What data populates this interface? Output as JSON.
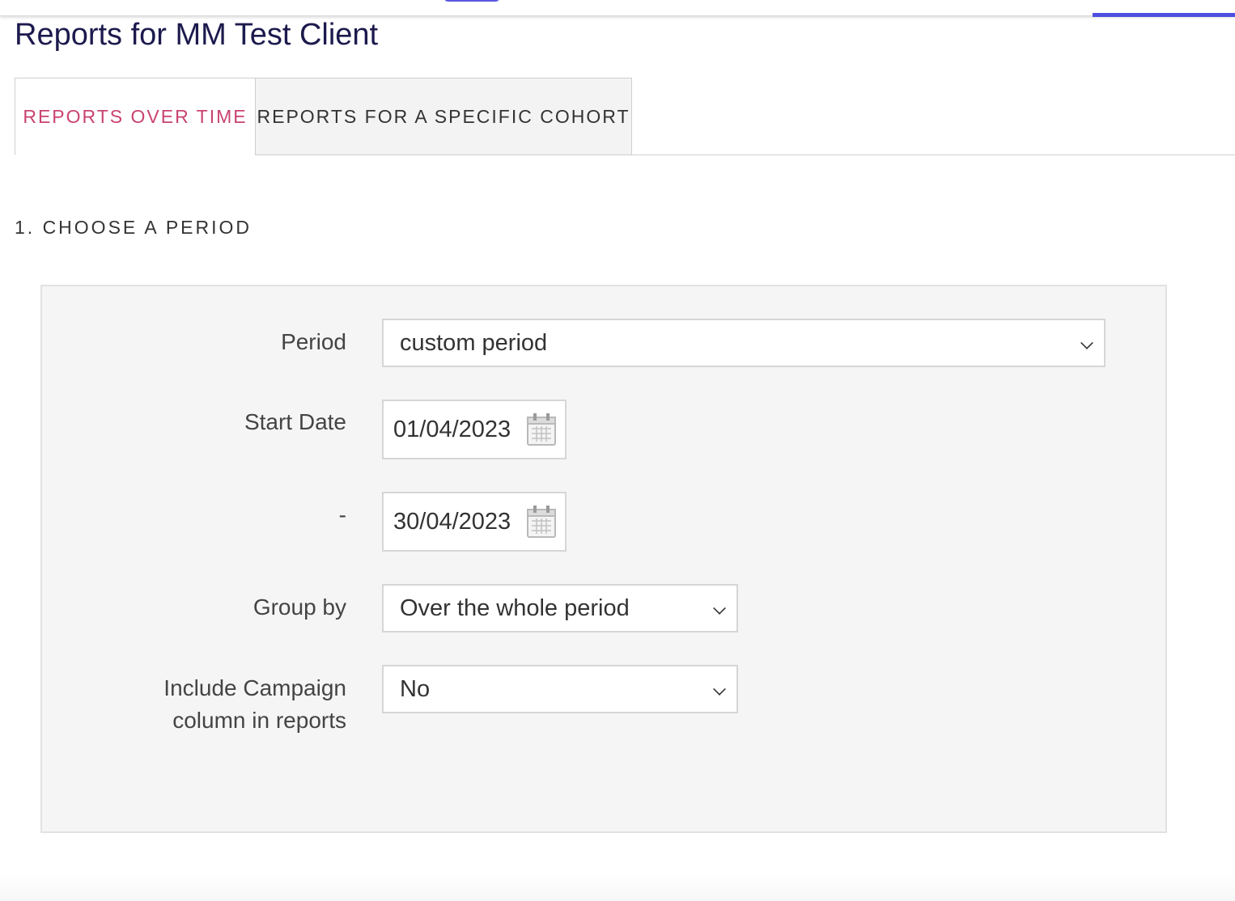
{
  "page": {
    "title": "Reports for MM Test Client"
  },
  "tabs": [
    {
      "label": "REPORTS OVER TIME",
      "active": true
    },
    {
      "label": "REPORTS FOR A SPECIFIC COHORT",
      "active": false
    }
  ],
  "section": {
    "heading": "1. CHOOSE A PERIOD"
  },
  "form": {
    "period": {
      "label": "Period",
      "value": "custom period"
    },
    "start_date": {
      "label": "Start Date",
      "value": "01/04/2023",
      "icon": "calendar-icon"
    },
    "end_date": {
      "label": "-",
      "value": "30/04/2023",
      "icon": "calendar-icon"
    },
    "group_by": {
      "label": "Group by",
      "value": "Over the whole period"
    },
    "include_campaign": {
      "label_line1": "Include Campaign",
      "label_line2": "column in reports",
      "value": "No"
    }
  },
  "colors": {
    "title": "#1c1a4d",
    "active_tab": "#c9436f",
    "accent_bar": "#4d4fe0",
    "panel_bg": "#f5f5f5"
  }
}
